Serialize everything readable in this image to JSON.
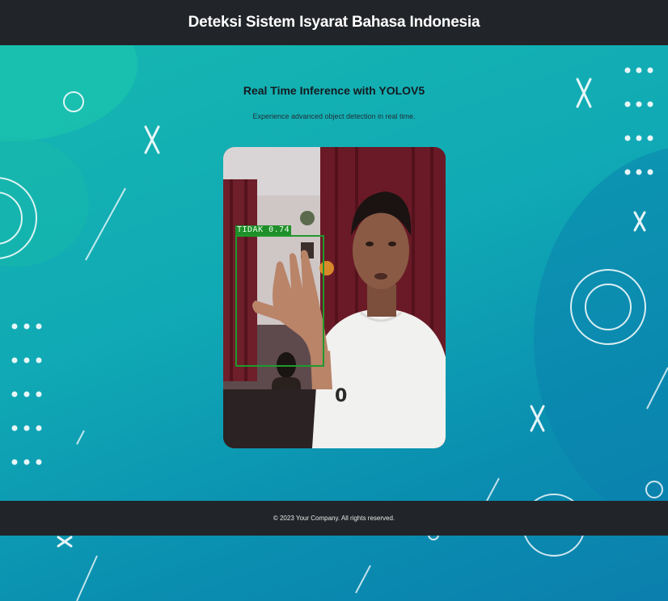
{
  "navbar": {
    "title": "Deteksi Sistem Isyarat Bahasa Indonesia"
  },
  "hero": {
    "title": "Real Time Inference with YOLOV5",
    "subtitle": "Experience advanced object detection in real time."
  },
  "video": {
    "detection": {
      "label": "TIDAK 0.74",
      "class": "TIDAK",
      "confidence": 0.74,
      "box_color": "#1f9a2b"
    }
  },
  "footer": {
    "copyright": "© 2023 Your Company. All rights reserved."
  },
  "colors": {
    "header_bg": "#212428",
    "background_start": "#17b9b0",
    "background_end": "#0b7fae",
    "decor_stroke": "#ffffff"
  }
}
